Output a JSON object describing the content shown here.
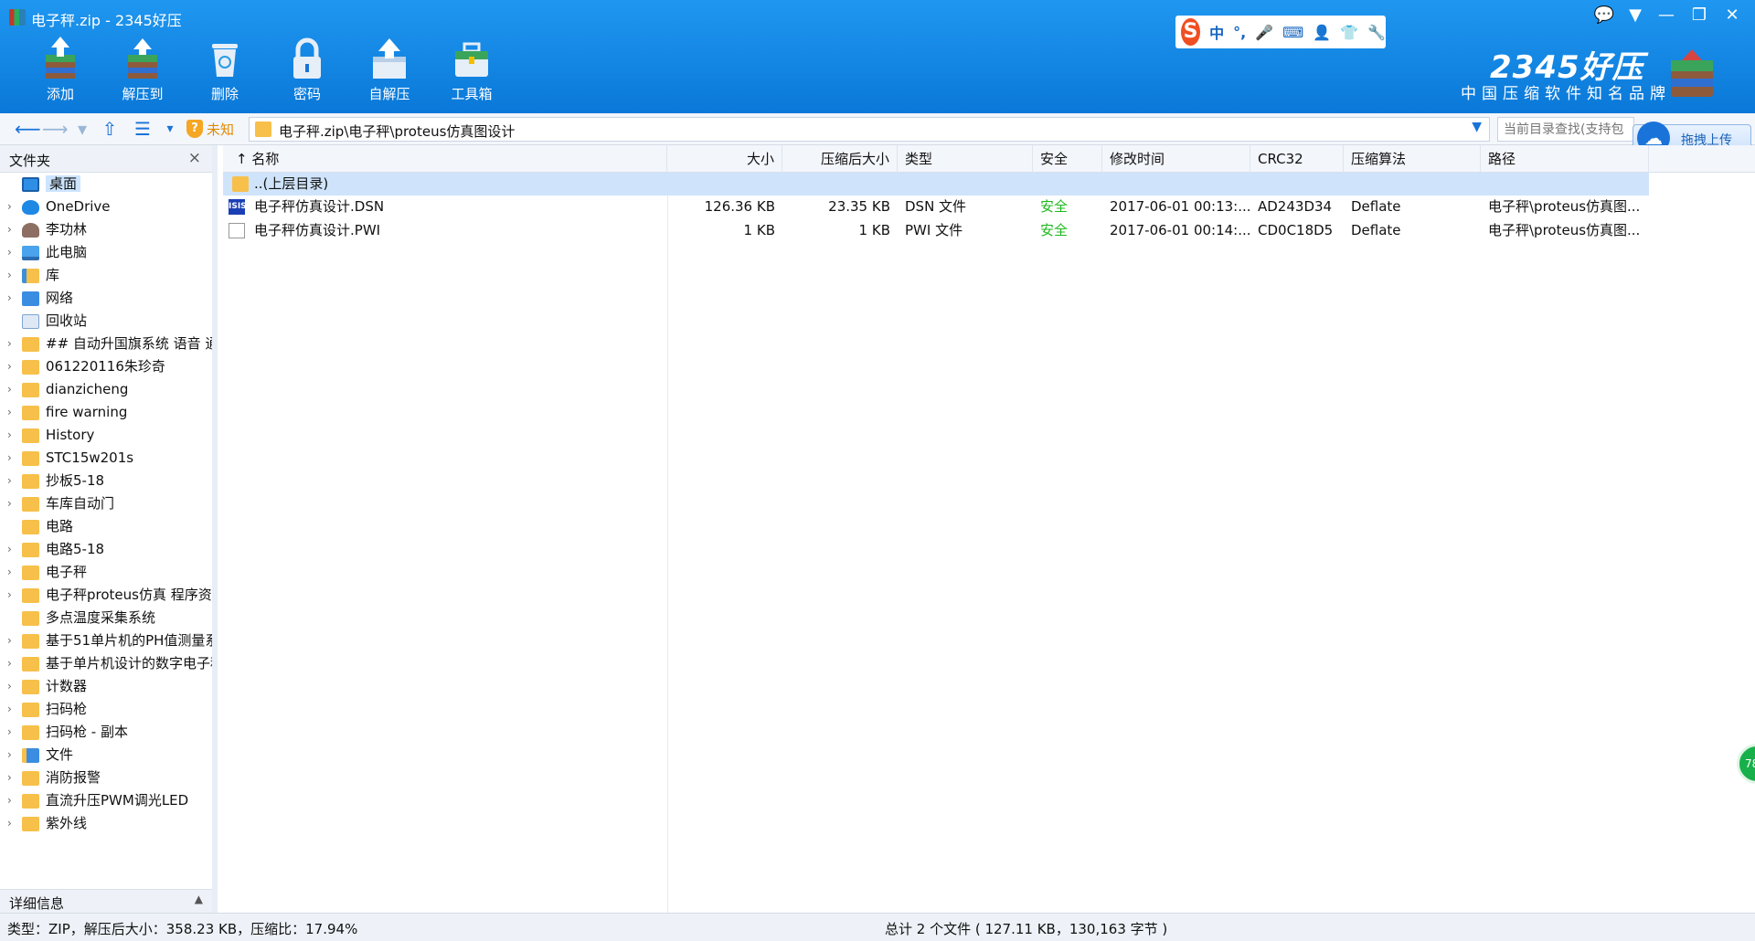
{
  "window": {
    "title": "电子秤.zip - 2345好压",
    "controls": [
      "💬",
      "▼",
      "—",
      "❐",
      "✕"
    ]
  },
  "toolbar": [
    {
      "label": "添加",
      "icon": "add-archive-icon"
    },
    {
      "label": "解压到",
      "icon": "extract-to-icon"
    },
    {
      "label": "删除",
      "icon": "recycle-bin-icon"
    },
    {
      "label": "密码",
      "icon": "lock-icon"
    },
    {
      "label": "自解压",
      "icon": "self-extract-icon"
    },
    {
      "label": "工具箱",
      "icon": "toolbox-icon"
    }
  ],
  "ime": {
    "logo": "S",
    "items": [
      "中",
      "°,",
      "🎤",
      "⌨",
      "👤",
      "👕",
      "🔧"
    ]
  },
  "brand": {
    "name": "2345好压",
    "slogan": "中国压缩软件知名品牌"
  },
  "address": {
    "security_label": "未知",
    "path": "电子秤.zip\\电子秤\\proteus仿真图设计",
    "search_placeholder": "当前目录查找(支持包",
    "upload_label": "拖拽上传"
  },
  "sidebar": {
    "title": "文件夹",
    "close": "×",
    "details_label": "详细信息",
    "items": [
      {
        "label": "桌面",
        "icon": "desktop",
        "arrow": "",
        "selected": true
      },
      {
        "label": "OneDrive",
        "icon": "cloud",
        "arrow": "›"
      },
      {
        "label": "李功林",
        "icon": "user",
        "arrow": "›"
      },
      {
        "label": "此电脑",
        "icon": "pc",
        "arrow": "›"
      },
      {
        "label": "库",
        "icon": "lib",
        "arrow": "›"
      },
      {
        "label": "网络",
        "icon": "net",
        "arrow": "›"
      },
      {
        "label": "回收站",
        "icon": "bin",
        "arrow": ""
      },
      {
        "label": "## 自动升国旗系统 语音 通",
        "icon": "folder",
        "arrow": "›"
      },
      {
        "label": "061220116朱珍奇",
        "icon": "folder",
        "arrow": "›"
      },
      {
        "label": "dianzicheng",
        "icon": "folder",
        "arrow": "›"
      },
      {
        "label": "fire warning",
        "icon": "folder",
        "arrow": "›"
      },
      {
        "label": "History",
        "icon": "folder",
        "arrow": "›"
      },
      {
        "label": "STC15w201s",
        "icon": "folder",
        "arrow": "›"
      },
      {
        "label": "抄板5-18",
        "icon": "folder",
        "arrow": "›"
      },
      {
        "label": "车库自动门",
        "icon": "folder",
        "arrow": "›"
      },
      {
        "label": "电路",
        "icon": "folder",
        "arrow": ""
      },
      {
        "label": "电路5-18",
        "icon": "folder",
        "arrow": "›"
      },
      {
        "label": "电子秤",
        "icon": "folder",
        "arrow": "›"
      },
      {
        "label": "电子秤proteus仿真 程序资料",
        "icon": "folder",
        "arrow": "›"
      },
      {
        "label": "多点温度采集系统",
        "icon": "folder",
        "arrow": ""
      },
      {
        "label": "基于51单片机的PH值测量系",
        "icon": "folder",
        "arrow": "›"
      },
      {
        "label": "基于单片机设计的数字电子秤",
        "icon": "folder",
        "arrow": "›"
      },
      {
        "label": "计数器",
        "icon": "folder",
        "arrow": "›"
      },
      {
        "label": "扫码枪",
        "icon": "folder",
        "arrow": "›"
      },
      {
        "label": "扫码枪 - 副本",
        "icon": "folder",
        "arrow": "›"
      },
      {
        "label": "文件",
        "icon": "file",
        "arrow": "›"
      },
      {
        "label": "消防报警",
        "icon": "folder",
        "arrow": "›"
      },
      {
        "label": "直流升压PWM调光LED",
        "icon": "folder",
        "arrow": "›"
      },
      {
        "label": "紫外线",
        "icon": "folder",
        "arrow": "›"
      }
    ]
  },
  "filelist": {
    "sort_arrow": "↑",
    "columns": [
      "名称",
      "大小",
      "压缩后大小",
      "类型",
      "安全",
      "修改时间",
      "CRC32",
      "压缩算法",
      "路径"
    ],
    "parent_row": "..(上层目录)",
    "rows": [
      {
        "icon": "dsn",
        "icon_text": "ISIS",
        "name": "电子秤仿真设计.DSN",
        "size": "126.36 KB",
        "packed": "23.35 KB",
        "type": "DSN 文件",
        "safety": "安全",
        "modified": "2017-06-01 00:13:...",
        "crc": "AD243D34",
        "method": "Deflate",
        "path": "电子秤\\proteus仿真图..."
      },
      {
        "icon": "doc",
        "icon_text": "",
        "name": "电子秤仿真设计.PWI",
        "size": "1 KB",
        "packed": "1 KB",
        "type": "PWI 文件",
        "safety": "安全",
        "modified": "2017-06-01 00:14:...",
        "crc": "CD0C18D5",
        "method": "Deflate",
        "path": "电子秤\\proteus仿真图..."
      }
    ]
  },
  "status": {
    "left": "类型：ZIP，解压后大小：358.23 KB，压缩比：17.94%",
    "middle": "总计 2 个文件 ( 127.11 KB，130,163 字节 )"
  },
  "float_ball": {
    "text": "78"
  },
  "colors": {
    "accent": "#0a78d8",
    "safe": "#1db81d",
    "selection": "#cfe4fb"
  }
}
